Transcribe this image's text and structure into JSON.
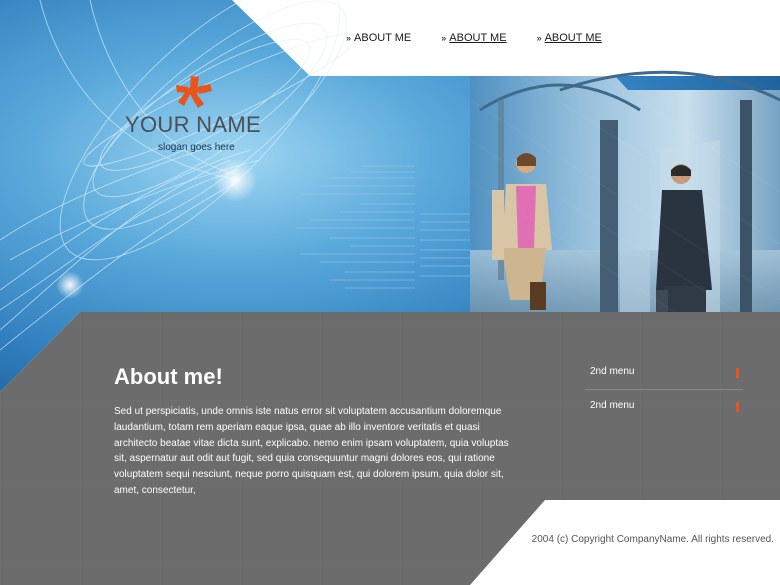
{
  "nav": {
    "links": [
      {
        "label": "ABOUT ME",
        "marker": "»",
        "active": false
      },
      {
        "label": "ABOUT ME",
        "marker": "»",
        "active": true
      },
      {
        "label": "ABOUT ME",
        "marker": "»",
        "active": true
      }
    ]
  },
  "logo": {
    "name": "YOUR NAME",
    "slogan": "slogan goes here",
    "mark_icon": "asterisk-icon"
  },
  "about": {
    "title": "About me!",
    "text": "Sed ut perspiciatis, unde omnis iste natus error sit voluptatem accusantium doloremque laudantium, totam rem aperiam eaque ipsa, quae ab illo inventore veritatis et quasi architecto beatae vitae dicta sunt, explicabo. nemo enim ipsam voluptatem, quia voluptas sit, aspernatur aut odit aut fugit, sed quia consequuntur magni dolores eos, qui ratione voluptatem sequi nesciunt, neque porro quisquam est, qui dolorem ipsum, quia dolor sit, amet, consectetur,"
  },
  "submenu": {
    "items": [
      {
        "label": "2nd menu"
      },
      {
        "label": "2nd menu"
      }
    ]
  },
  "footer": {
    "copyright": "2004 (c) Copyright CompanyName. All rights reserved."
  },
  "colors": {
    "accent": "#e8541c",
    "blue_header": "#4a9ad0",
    "content_gray": "#6c6c6c"
  }
}
